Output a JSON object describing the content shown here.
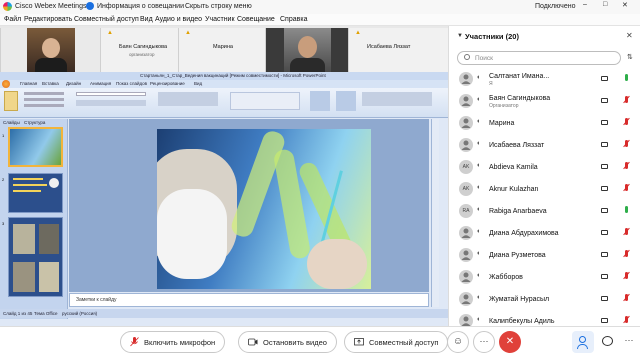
{
  "app": {
    "title": "Cisco Webex Meetings",
    "meeting_info": "Информация о совещании",
    "hide_menu": "Скрыть строку меню",
    "connection": "Подключено"
  },
  "menu": [
    "Файл",
    "Редактировать",
    "Совместный доступ",
    "Вид",
    "Аудио и видео",
    "Участник",
    "Совещание",
    "Справка"
  ],
  "thumbnails": [
    {
      "name": "",
      "role": ""
    },
    {
      "name": "Баян Сагиндыкова",
      "role": "организатор"
    },
    {
      "name": "Марина",
      "role": ""
    },
    {
      "name": "",
      "role": ""
    },
    {
      "name": "Исабаева Ляззат",
      "role": ""
    }
  ],
  "ppt": {
    "title": "Стартаньян_1_Стар_Ведения вакцинаций [Режим совместимости] - Microsoft PowerPoint",
    "tabs": [
      "Главная",
      "Вставка",
      "Дизайн",
      "Анимация",
      "Показ слайдов",
      "Рецензирование",
      "Вид"
    ],
    "notes": "Заметки к слайду",
    "status": "Слайд 1 из 45",
    "theme": "Тема Office",
    "lang": "русский (Россия)",
    "slides_tab": "Слайды",
    "outline_tab": "Структура",
    "slide_numbers": [
      "1",
      "2",
      "3"
    ]
  },
  "participants": {
    "header": "Участники (20)",
    "search_placeholder": "Поиск",
    "list": [
      {
        "name": "Салтанат Имана...",
        "role": "Я",
        "initials": "",
        "mic_muted": false
      },
      {
        "name": "Баян Сагиндыкова",
        "role": "Организатор",
        "initials": "",
        "mic_muted": true
      },
      {
        "name": "Марина",
        "role": "",
        "initials": "",
        "mic_muted": true
      },
      {
        "name": "Исабаева Ляззат",
        "role": "",
        "initials": "",
        "mic_muted": true
      },
      {
        "name": "Abdieva Kamila",
        "role": "",
        "initials": "AK",
        "mic_muted": true
      },
      {
        "name": "Aknur Kulazhan",
        "role": "",
        "initials": "AK",
        "mic_muted": true
      },
      {
        "name": "Rabiga Anarbaeva",
        "role": "",
        "initials": "RA",
        "mic_muted": false
      },
      {
        "name": "Диана Абдурахимова",
        "role": "",
        "initials": "",
        "mic_muted": true
      },
      {
        "name": "Диана Рузметова",
        "role": "",
        "initials": "",
        "mic_muted": true
      },
      {
        "name": "Жабборов",
        "role": "",
        "initials": "",
        "mic_muted": true
      },
      {
        "name": "Жуматай Нурасыл",
        "role": "",
        "initials": "",
        "mic_muted": true
      },
      {
        "name": "Калипбекулы Адиль",
        "role": "",
        "initials": "",
        "mic_muted": true
      }
    ]
  },
  "controls": {
    "mic": "Включить микрофон",
    "video": "Остановить видео",
    "share": "Совместный доступ"
  },
  "colors": {
    "accent": "#1a6fe0",
    "muted_red": "#d82b2b",
    "end_red": "#e0413a",
    "mic_green": "#2eae4a"
  }
}
